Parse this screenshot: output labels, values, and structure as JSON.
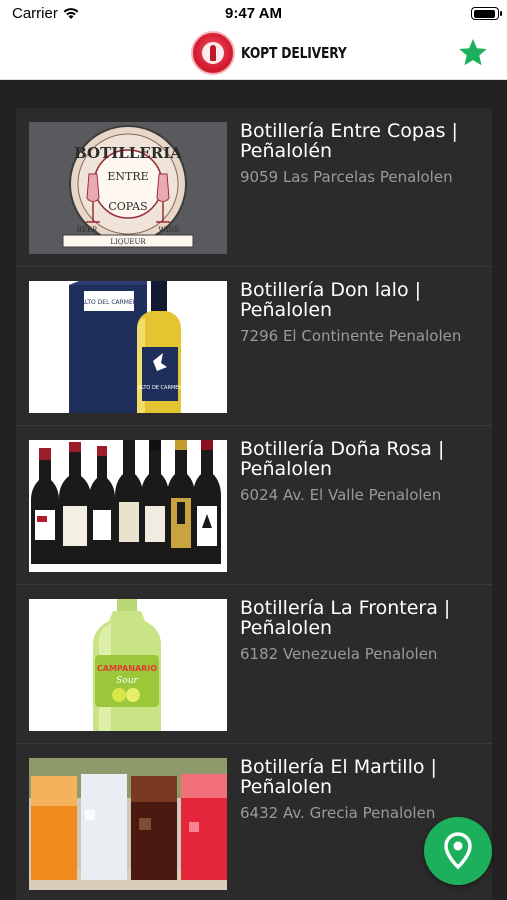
{
  "status_bar": {
    "carrier": "Carrier",
    "time": "9:47 AM"
  },
  "header": {
    "app_name": "KOPT DELIVERY",
    "favorite_icon": "star-icon",
    "accent_color": "#1db05c"
  },
  "stores": [
    {
      "name": "Botillería Entre Copas | Peñalolén",
      "address": "9059 Las Parcelas Penalolen",
      "image": "entre-copas-logo",
      "logo_text": [
        "BOTILLERIA",
        "ENTRE",
        "COPAS",
        "BEER",
        "LIQUEUR",
        "WINE"
      ]
    },
    {
      "name": "Botillería Don lalo | Peñalolen",
      "address": "7296 El Continente Penalolen",
      "image": "alto-del-carmen-pisco",
      "label_text": [
        "ALTO DEL CARMEN",
        "ALTO DE CARMEN"
      ]
    },
    {
      "name": "Botillería Doña Rosa | Peñalolen",
      "address": "6024 Av. El Valle Penalolen",
      "image": "wine-bottles"
    },
    {
      "name": "Botillería La Frontera | Peñalolen",
      "address": "6182 Venezuela Penalolen",
      "image": "campanario-sour-bottle",
      "label_text": [
        "CAMPANARIO",
        "Sour"
      ]
    },
    {
      "name": "Botillería El Martillo | Peñalolen",
      "address": "6432 Av. Grecia Penalolen",
      "image": "mixed-drinks-glasses"
    }
  ],
  "map_button": {
    "icon": "map-pin-icon"
  }
}
